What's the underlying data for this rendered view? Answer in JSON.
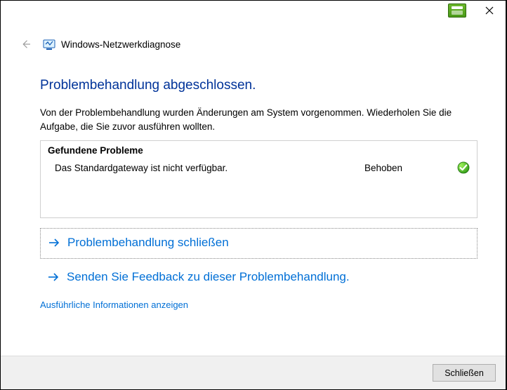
{
  "titlebar": {
    "close_tooltip": "Schließen"
  },
  "header": {
    "wizard_title": "Windows-Netzwerkdiagnose"
  },
  "page": {
    "heading": "Problembehandlung abgeschlossen.",
    "description": "Von der Problembehandlung wurden Änderungen am System vorgenommen. Wiederholen Sie die Aufgabe, die Sie zuvor ausführen wollten."
  },
  "problems": {
    "header": "Gefundene Probleme",
    "items": [
      {
        "description": "Das Standardgateway ist nicht verfügbar.",
        "status": "Behoben",
        "resolved": true
      }
    ]
  },
  "actions": {
    "close_troubleshooting": "Problembehandlung schließen",
    "send_feedback": "Senden Sie Feedback zu dieser Problembehandlung.",
    "details": "Ausführliche Informationen anzeigen"
  },
  "footer": {
    "close_button": "Schließen"
  }
}
